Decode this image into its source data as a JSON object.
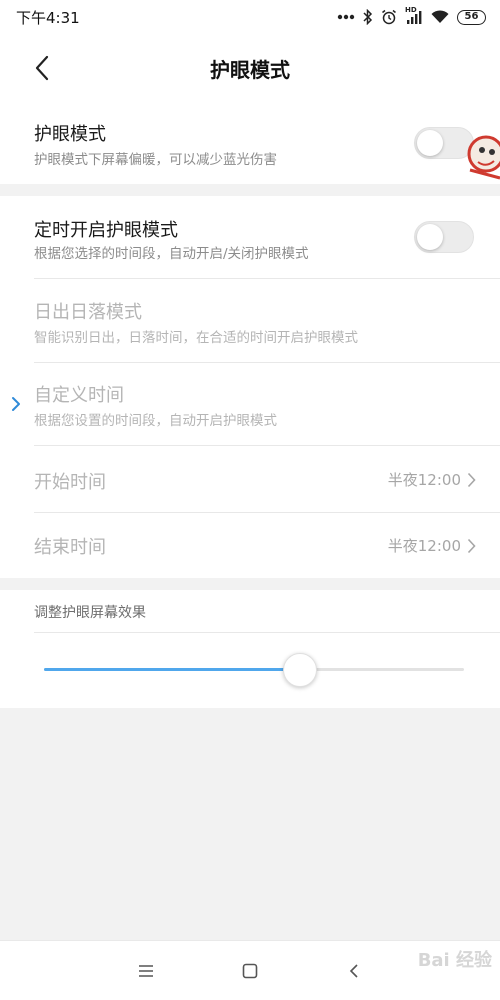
{
  "status_bar": {
    "time": "下午4:31",
    "network": "HD",
    "battery": "56"
  },
  "nav": {
    "title": "护眼模式"
  },
  "eye_mode": {
    "title": "护眼模式",
    "subtitle": "护眼模式下屏幕偏暖，可以减少蓝光伤害",
    "enabled": false
  },
  "schedule": {
    "title": "定时开启护眼模式",
    "subtitle": "根据您选择的时间段，自动开启/关闭护眼模式",
    "enabled": false,
    "sunrise": {
      "title": "日出日落模式",
      "subtitle": "智能识别日出，日落时间，在合适的时间开启护眼模式"
    },
    "custom": {
      "title": "自定义时间",
      "subtitle": "根据您设置的时间段，自动开启护眼模式"
    },
    "start": {
      "label": "开始时间",
      "value": "半夜12:00"
    },
    "end": {
      "label": "结束时间",
      "value": "半夜12:00"
    }
  },
  "adjust": {
    "title": "调整护眼屏幕效果",
    "level": 0.61
  },
  "colors": {
    "accent": "#50a7ec",
    "selected_indicator": "#2f8ad8"
  },
  "watermark": "Bai 经验"
}
